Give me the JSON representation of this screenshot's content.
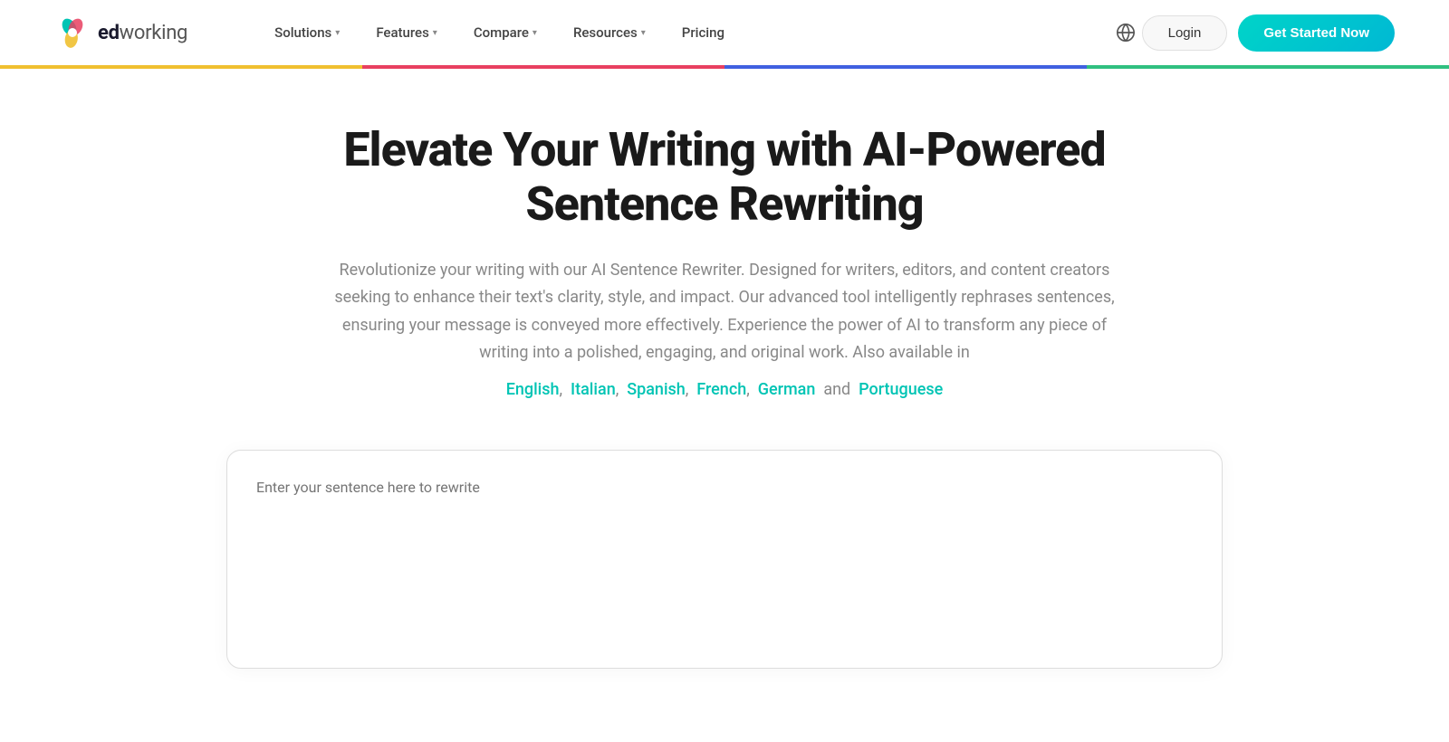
{
  "logo": {
    "text_ed": "ed",
    "text_working": "working",
    "alt": "Edworking logo"
  },
  "nav": {
    "items": [
      {
        "id": "solutions",
        "label": "Solutions",
        "has_dropdown": true
      },
      {
        "id": "features",
        "label": "Features",
        "has_dropdown": true
      },
      {
        "id": "compare",
        "label": "Compare",
        "has_dropdown": true
      },
      {
        "id": "resources",
        "label": "Resources",
        "has_dropdown": true
      },
      {
        "id": "pricing",
        "label": "Pricing",
        "has_dropdown": false
      }
    ],
    "globe_label": "Language selector"
  },
  "header": {
    "login_label": "Login",
    "get_started_label": "Get Started Now"
  },
  "color_bar": {
    "segments": [
      {
        "color": "#f0c030",
        "width": "25%"
      },
      {
        "color": "#e84060",
        "width": "25%"
      },
      {
        "color": "#4060e0",
        "width": "25%"
      },
      {
        "color": "#30c080",
        "width": "25%"
      }
    ]
  },
  "hero": {
    "title": "Elevate Your Writing with AI-Powered Sentence Rewriting",
    "description": "Revolutionize your writing with our AI Sentence Rewriter. Designed for writers, editors, and content creators seeking to enhance their text's clarity, style, and impact. Our advanced tool intelligently rephrases sentences, ensuring your message is conveyed more effectively. Experience the power of AI to transform any piece of writing into a polished, engaging, and original work. Also available in",
    "languages": [
      {
        "label": "English",
        "href": "#"
      },
      {
        "label": "Italian",
        "href": "#"
      },
      {
        "label": "Spanish",
        "href": "#"
      },
      {
        "label": "French",
        "href": "#"
      },
      {
        "label": "German",
        "href": "#"
      }
    ],
    "and_text": "and",
    "last_language": {
      "label": "Portuguese",
      "href": "#"
    }
  },
  "textarea": {
    "placeholder": "Enter your sentence here to rewrite"
  }
}
